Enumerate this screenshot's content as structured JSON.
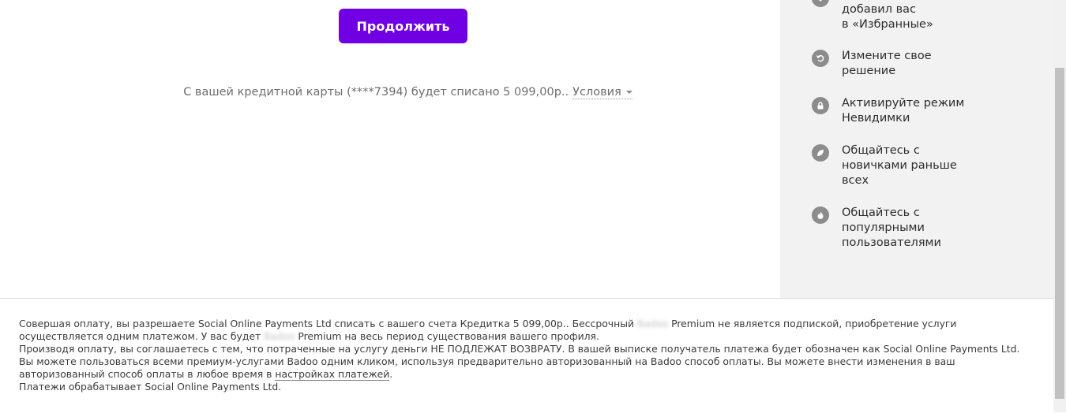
{
  "main": {
    "continue_label": "Продолжить",
    "charge_text": "С вашей кредитной карты (****7394) будет списано 5 099,00р..",
    "terms_label": "Условия"
  },
  "sidebar": {
    "items": [
      {
        "label_line1": "добавил вас",
        "label_line2": "в «Избранные»",
        "icon": "favorite-icon"
      },
      {
        "label": "Измените свое решение",
        "icon": "undo-icon"
      },
      {
        "label": "Активируйте режим Невидимки",
        "icon": "lock-icon"
      },
      {
        "label": "Общайтесь с новичками раньше всех",
        "icon": "leaf-icon"
      },
      {
        "label": "Общайтесь с популярными пользователями",
        "icon": "fire-icon"
      }
    ]
  },
  "footer": {
    "p1a": "Совершая оплату, вы разрешаете Social Online Payments Ltd списать с вашего счета Кредитка 5 099,00р.. Бессрочный",
    "blur1": "Badoo",
    "p1b": "Premium не является подпиской, приобретение услуги осуществляется одним платежом. У вас будет",
    "blur2": "Badoo",
    "p1c": "Premium на весь период существования вашего профиля.",
    "p2": "Производя оплату, вы соглашаетесь с тем, что потраченные на услугу деньги НЕ ПОДЛЕЖАТ ВОЗВРАТУ. В вашей выписке получатель платежа будет обозначен как Social Online Payments Ltd.",
    "p3a": "Вы можете пользоваться всеми премиум-услугами Badoo одним кликом, используя предварительно авторизованный на Badoo способ оплаты. Вы можете внести изменения в ваш авторизованный способ оплаты в любое время в",
    "p3_link": "настройках платежей",
    "p3b": ".",
    "p4": "Платежи обрабатывает Social Online Payments Ltd."
  },
  "colors": {
    "accent": "#7000e3",
    "sidebar_bg": "#f2f2f2",
    "icon_bg": "#8c8c8c"
  }
}
